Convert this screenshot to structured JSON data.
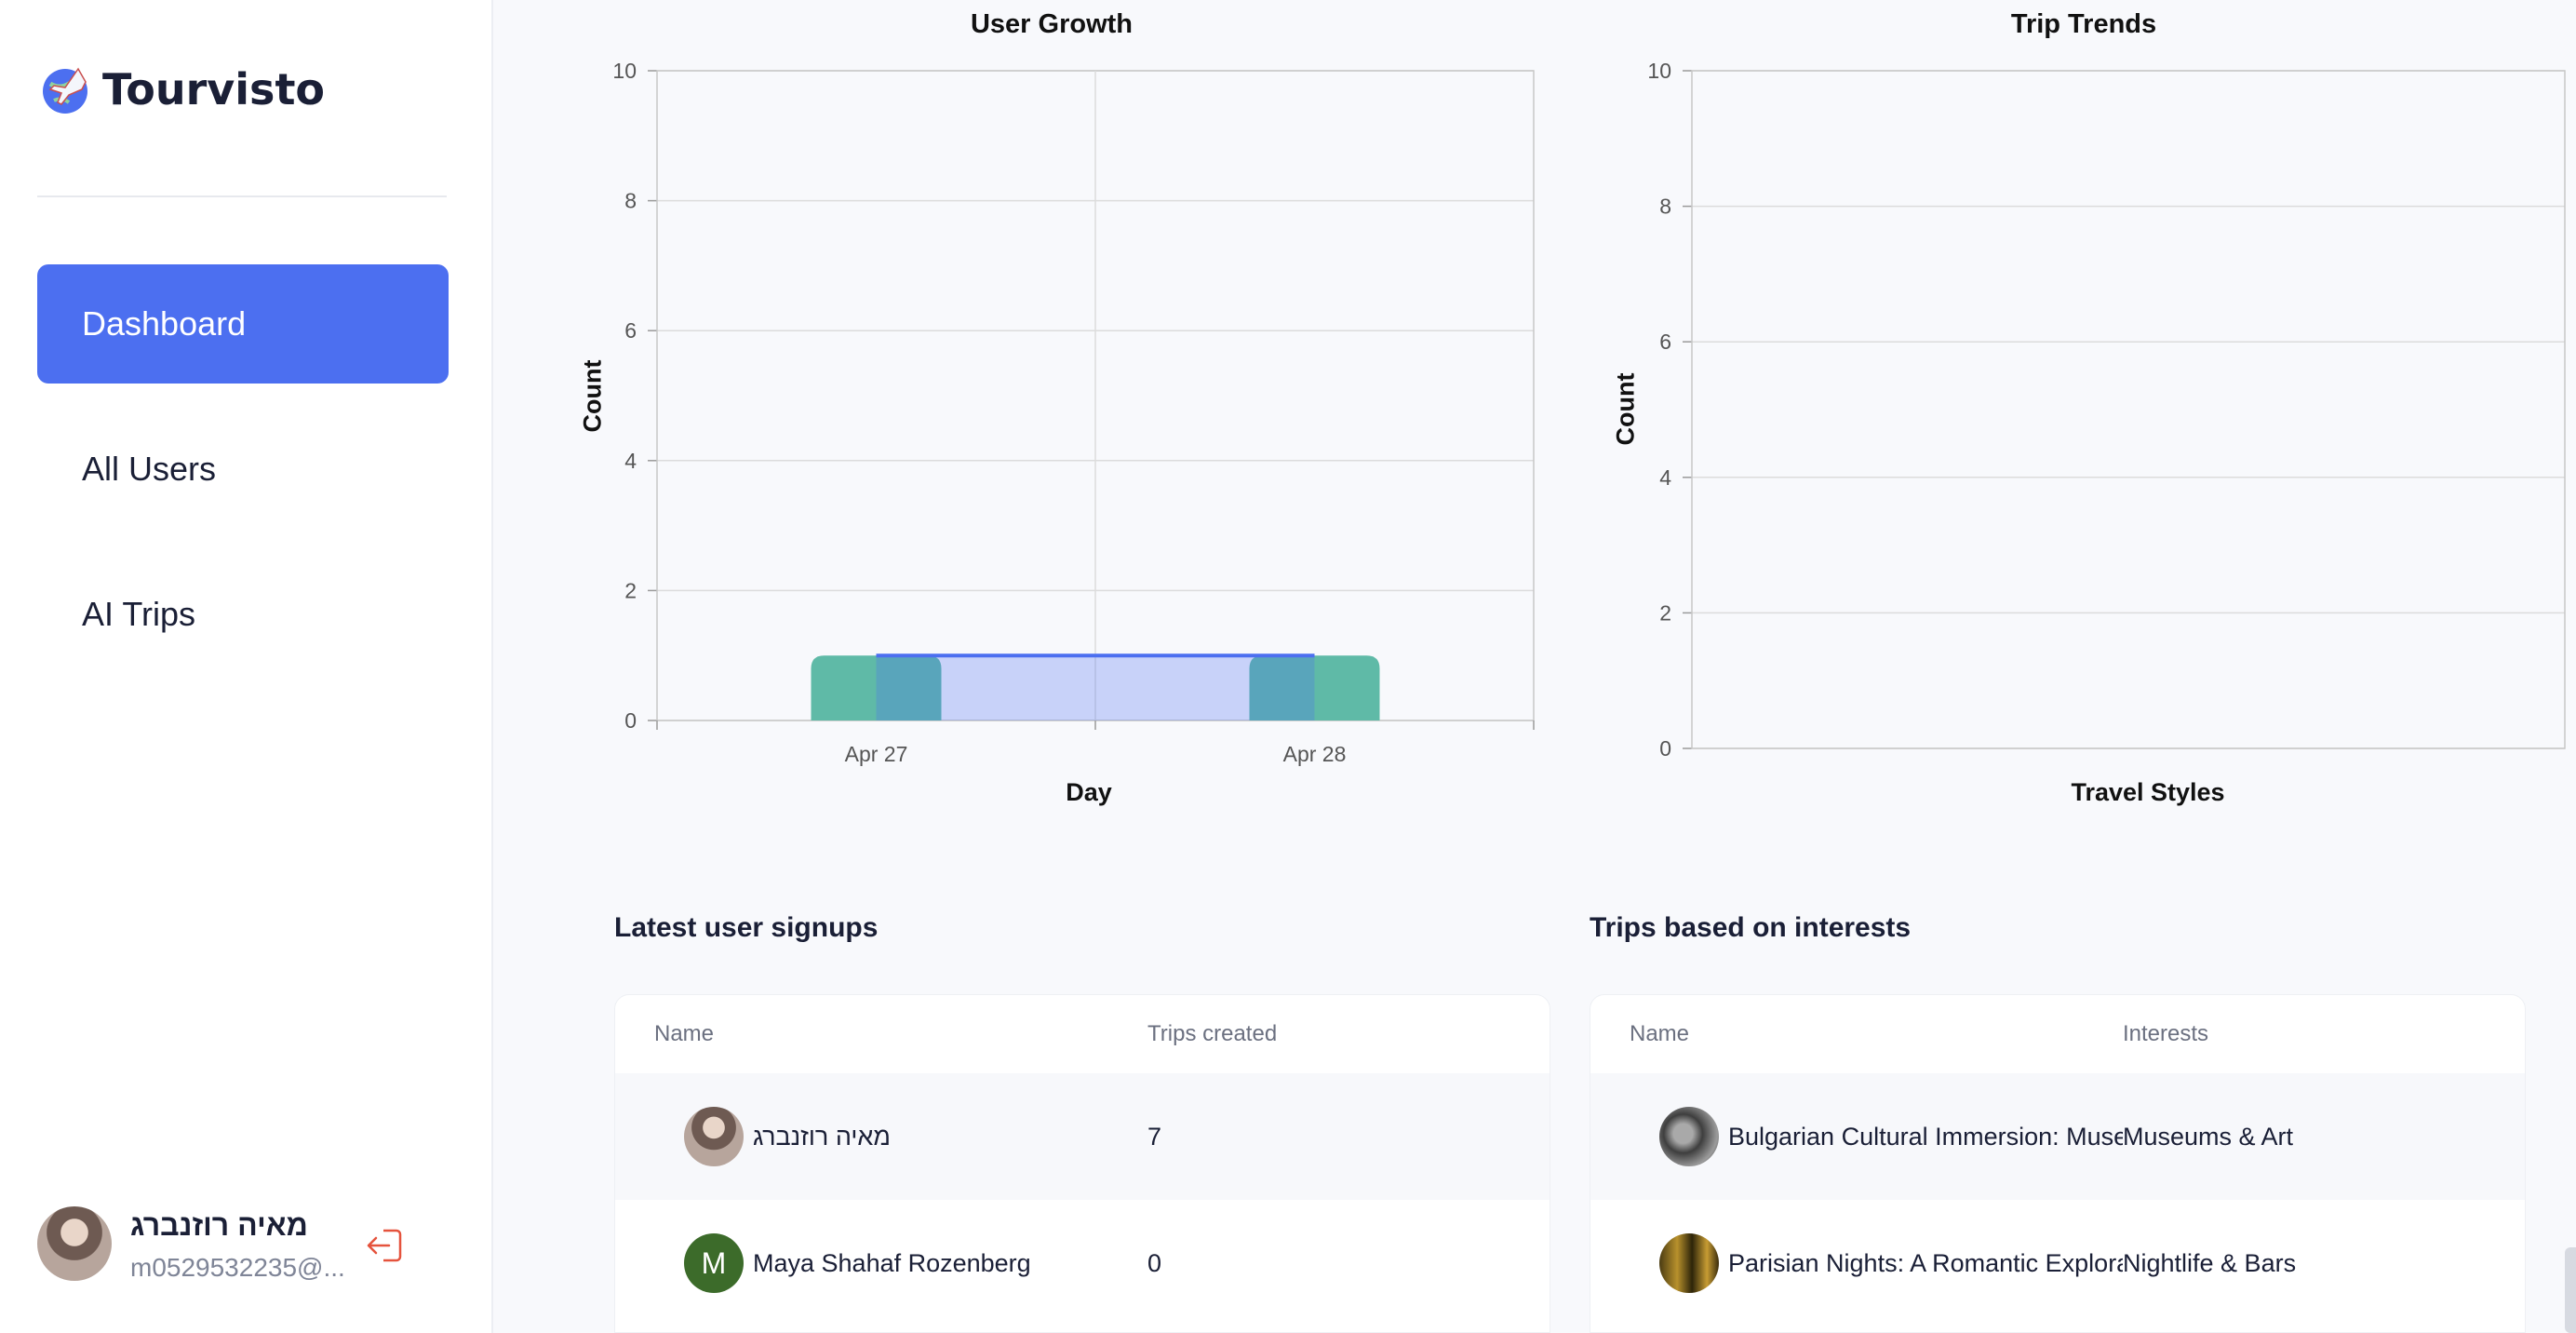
{
  "app": {
    "name": "Tourvisto",
    "logo_icon": "airplane-globe-icon"
  },
  "sidebar": {
    "items": [
      {
        "label": "Dashboard",
        "active": true
      },
      {
        "label": "All Users",
        "active": false
      },
      {
        "label": "AI Trips",
        "active": false
      }
    ]
  },
  "profile": {
    "name": "מאיה רוזנברג",
    "email": "m0529532235@...",
    "logout_icon": "logout-icon"
  },
  "charts": {
    "user_growth": {
      "title": "User Growth",
      "xlabel": "Day",
      "ylabel": "Count"
    },
    "trip_trends": {
      "title": "Trip Trends",
      "xlabel": "Travel Styles",
      "ylabel": "Count"
    }
  },
  "chart_data": [
    {
      "type": "bar",
      "title": "User Growth",
      "xlabel": "Day",
      "ylabel": "Count",
      "categories": [
        "Apr 27",
        "Apr 28"
      ],
      "series": [
        {
          "type": "bar",
          "values": [
            1,
            1
          ],
          "color": "#5fbaa7"
        },
        {
          "type": "area",
          "values": [
            1,
            1
          ],
          "color": "#4c6ff0"
        }
      ],
      "ylim": [
        0,
        10
      ],
      "yticks": [
        0,
        2,
        4,
        6,
        8,
        10
      ],
      "grid": true
    },
    {
      "type": "bar",
      "title": "Trip Trends",
      "xlabel": "Travel Styles",
      "ylabel": "Count",
      "categories": [],
      "series": [],
      "ylim": [
        0,
        10
      ],
      "yticks": [
        0,
        2,
        4,
        6,
        8,
        10
      ],
      "grid": true
    }
  ],
  "tables": {
    "signups": {
      "title": "Latest user signups",
      "headers": [
        "Name",
        "Trips created"
      ],
      "rows": [
        {
          "name": "מאיה רוזנברג",
          "value": "7",
          "avatar": "photo"
        },
        {
          "name": "Maya Shahaf Rozenberg",
          "value": "0",
          "avatar": "M"
        }
      ]
    },
    "trips": {
      "title": "Trips based on interests",
      "headers": [
        "Name",
        "Interests"
      ],
      "rows": [
        {
          "name": "Bulgarian Cultural Immersion: Museums and Art",
          "value": "Museums & Art"
        },
        {
          "name": "Parisian Nights: A Romantic Exploration",
          "value": "Nightlife & Bars"
        }
      ]
    }
  }
}
